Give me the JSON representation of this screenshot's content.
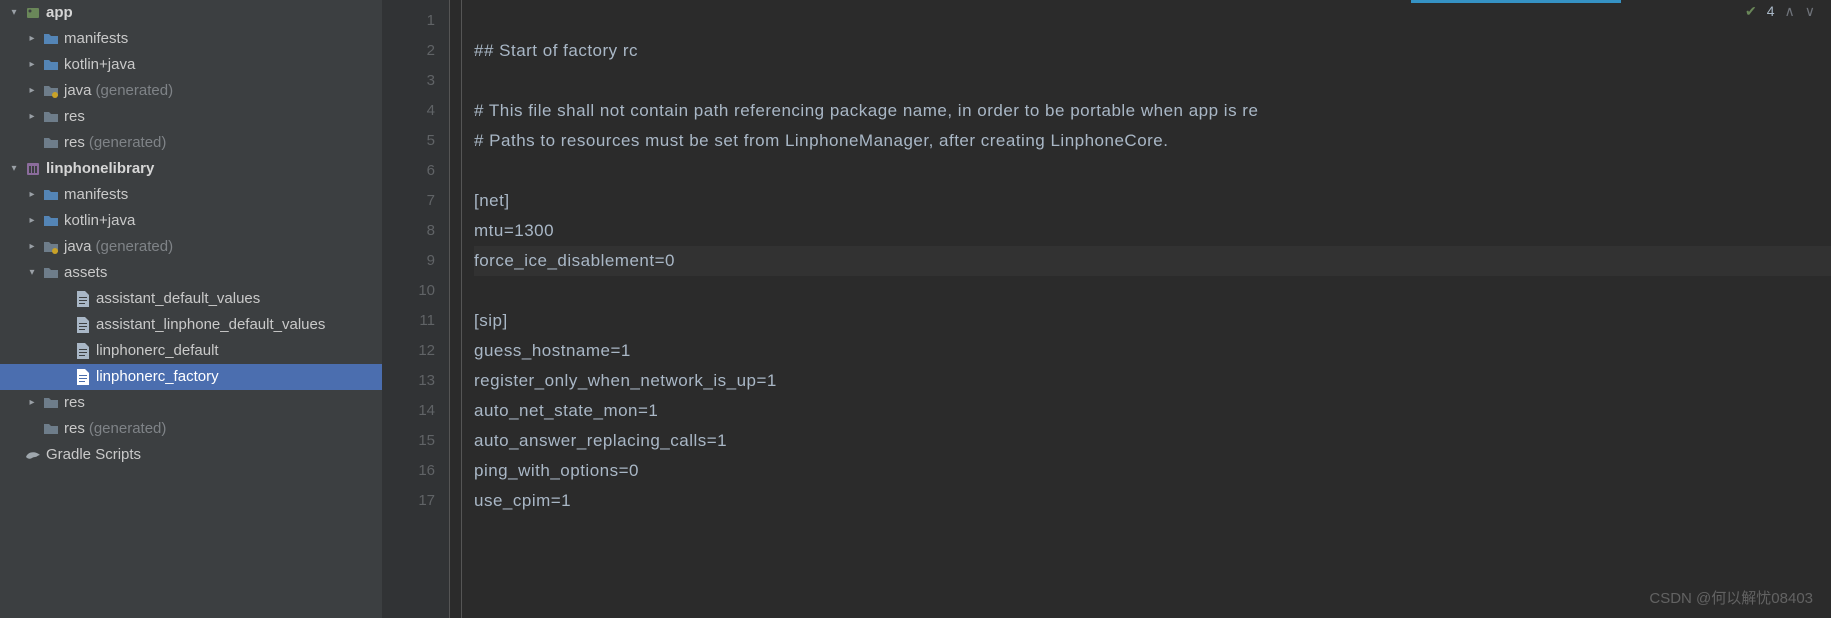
{
  "tree": {
    "app": "app",
    "manifests": "manifests",
    "kotlinjava": "kotlin+java",
    "java": "java",
    "generated": "(generated)",
    "res": "res",
    "linphonelibrary": "linphonelibrary",
    "assets": "assets",
    "assistant_default_values": "assistant_default_values",
    "assistant_linphone_default_values": "assistant_linphone_default_values",
    "linphonerc_default": "linphonerc_default",
    "linphonerc_factory": "linphonerc_factory",
    "gradle_scripts": "Gradle Scripts"
  },
  "editor": {
    "status_count": "4",
    "lines": [
      "",
      "## Start of factory rc",
      "",
      "# This file shall not contain path referencing package name, in order to be portable when app is re",
      "# Paths to resources must be set from LinphoneManager, after creating LinphoneCore.",
      "",
      "[net]",
      "mtu=1300",
      "force_ice_disablement=0",
      "",
      "[sip]",
      "guess_hostname=1",
      "register_only_when_network_is_up=1",
      "auto_net_state_mon=1",
      "auto_answer_replacing_calls=1",
      "ping_with_options=0",
      "use_cpim=1"
    ],
    "current_line": 9
  },
  "watermark": "CSDN @何以解忧08403"
}
